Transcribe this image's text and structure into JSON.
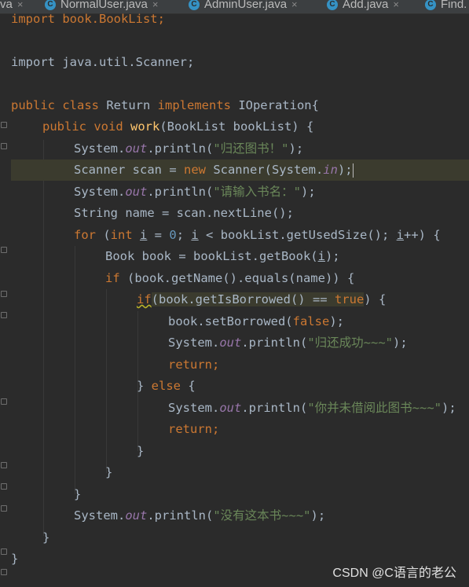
{
  "tabs": [
    {
      "label": "va",
      "has_icon": false
    },
    {
      "label": "NormalUser.java",
      "has_icon": true
    },
    {
      "label": "AdminUser.java",
      "has_icon": true
    },
    {
      "label": "Add.java",
      "has_icon": true
    },
    {
      "label": "Find.",
      "has_icon": true
    }
  ],
  "tab_close_glyph": "×",
  "tab_icon_letter": "C",
  "code": {
    "l1": {
      "a": "import book.BookList;"
    },
    "l2": {
      "a": "import java.util.Scanner;"
    },
    "l3": {
      "a": "public class ",
      "b": "Return",
      "c": " implements ",
      "d": "IOperation{"
    },
    "l4": {
      "a": "public void ",
      "b": "work",
      "c": "(BookList bookList) {"
    },
    "l5": {
      "a": "System.",
      "b": "out",
      "c": ".println(",
      "d": "\"归还图书！\"",
      "e": ");"
    },
    "l6": {
      "a": "Scanner scan = ",
      "b": "new ",
      "c": "Scanner(System.",
      "d": "in",
      "e": ");"
    },
    "l7": {
      "a": "System.",
      "b": "out",
      "c": ".println(",
      "d": "\"请输入书名：\"",
      "e": ");"
    },
    "l8": {
      "a": "String name = scan.nextLine();"
    },
    "l9": {
      "a": "for ",
      "b": "(",
      "c": "int ",
      "d": "i",
      "e": " = ",
      "f": "0",
      "g": "; ",
      "h": "i",
      "i": " < bookList.getUsedSize(); ",
      "j": "i",
      "k": "++) {"
    },
    "l10": {
      "a": "Book book = bookList.getBook(",
      "b": "i",
      "c": ");"
    },
    "l11": {
      "a": "if ",
      "b": "(book.getName().equals(name)) {"
    },
    "l12": {
      "a": "if",
      "b": "(book.getIsBorrowed() == ",
      "c": "true",
      "d": ") {"
    },
    "l13": {
      "a": "book.setBorrowed(",
      "b": "false",
      "c": ");"
    },
    "l14": {
      "a": "System.",
      "b": "out",
      "c": ".println(",
      "d": "\"归还成功~~~\"",
      "e": ");"
    },
    "l15": {
      "a": "return;"
    },
    "l16": {
      "a": "} ",
      "b": "else ",
      "c": "{"
    },
    "l17": {
      "a": "System.",
      "b": "out",
      "c": ".println(",
      "d": "\"你并未借阅此图书~~~\"",
      "e": ");"
    },
    "l18": {
      "a": "return;"
    },
    "l19": {
      "a": "}"
    },
    "l20": {
      "a": "}"
    },
    "l21": {
      "a": "}"
    },
    "l22": {
      "a": "System.",
      "b": "out",
      "c": ".println(",
      "d": "\"没有这本书~~~\"",
      "e": ");"
    },
    "l23": {
      "a": "}"
    },
    "l24": {
      "a": "}"
    }
  },
  "watermark": "CSDN @C语言的老公",
  "colors": {
    "background": "#2b2b2b",
    "keyword": "#cc7832",
    "method_decl": "#ffc66d",
    "static_field": "#9876aa",
    "string": "#6a8759",
    "number": "#6897bb",
    "default_text": "#a9b7c6"
  }
}
